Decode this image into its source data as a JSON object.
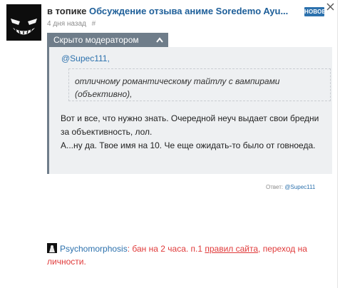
{
  "post": {
    "prefix": "в топике",
    "topic_title": "Обсуждение отзыва аниме Soredemo Ayu...",
    "new_badge": "НОВОЕ",
    "time": "4 дня назад",
    "anchor": "#"
  },
  "moderation": {
    "hidden_label": "Скрыто модератором"
  },
  "comment": {
    "mention": "@Supec111,",
    "quote": "отличному романтическому тайтлу с вампирами (объективно),",
    "line1": "Вот и все, что нужно знать. Очередной неуч выдает свои бредни за объективность, лол.",
    "line2": "А...ну да. Твое имя на 10. Че еще ожидать-то было от говноеда."
  },
  "reply": {
    "label": "Ответ:",
    "user": "@Supec111"
  },
  "mod_note": {
    "moderator": "Psychomorphosis",
    "text_before": ": бан на 2 часа. п.1 ",
    "rules_link": "правил сайта",
    "text_after": ", переход на личности."
  },
  "colors": {
    "link": "#2c71ad",
    "badge_bg": "#2c71ad",
    "moderated_bar": "#6f7d8a",
    "moderation_text": "#e03a3a"
  }
}
